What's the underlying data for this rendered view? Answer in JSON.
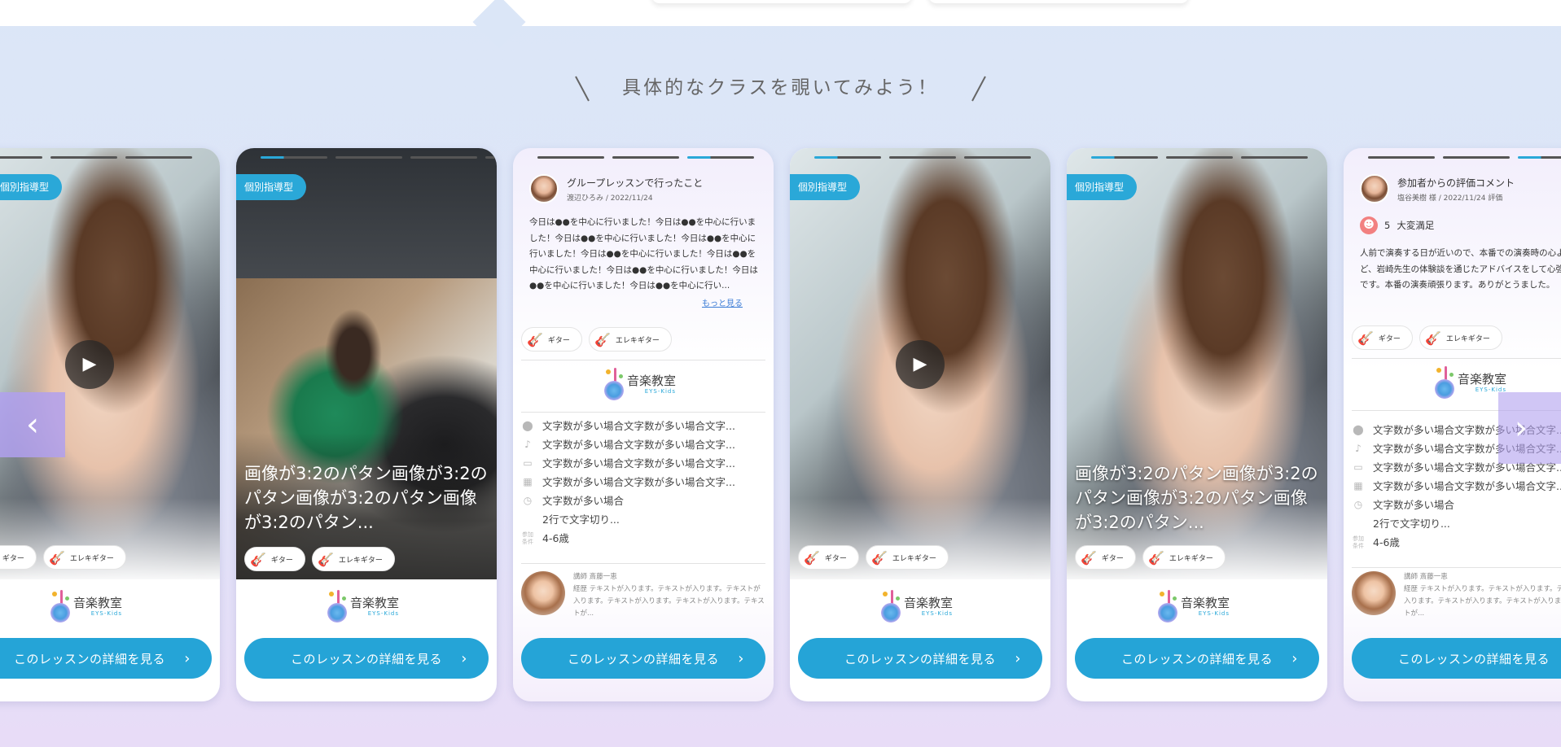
{
  "heading": "具体的なクラスを覗いてみよう！",
  "common": {
    "badge": "個別指導型",
    "tags": [
      "ギター",
      "エレキギター"
    ],
    "logo_name": "音楽教室",
    "logo_sub": "EYS-Kids",
    "cta": "このレッスンの詳細を見る",
    "play_icon": "▶"
  },
  "photo_caption": "画像が3:2のパタン画像が3:2のパタン画像が3:2のパタン画像が3:2のパタン...",
  "report": {
    "title": "グループレッスンで行ったこと",
    "meta": "渡辺ひろみ / 2022/11/24",
    "body": "今日は●●を中心に行いました！今日は●●を中心に行いました！今日は●●を中心に行いました！今日は●●を中心に行いました！今日は●●を中心に行いました！今日は●●を中心に行いました！今日は●●を中心に行いました！今日は●●を中心に行いました！今日は●●を中心に行い...",
    "more": "もっと見る"
  },
  "review": {
    "title": "参加者からの評価コメント",
    "meta": "塩谷美樹 様 / 2022/11/24 評価",
    "rating": "5",
    "rating_label": "大変満足",
    "body": "人前で演奏する日が近いので、本番での演奏時の心ようなど、岩崎先生の体験談を通じたアドバイスをして心強かったです。本番の演奏頑張ります。ありがとうました。"
  },
  "info": {
    "place": "文字数が多い場合文字数が多い場合文字...",
    "music": "文字数が多い場合文字数が多い場合文字...",
    "style": "文字数が多い場合文字数が多い場合文字...",
    "date": "文字数が多い場合文字数が多い場合文字...",
    "time_1": "文字数が多い場合",
    "time_2": "2行で文字切り...",
    "cond_label": "参加条件",
    "age": "4-6歳"
  },
  "teacher": {
    "name": "講師 斎藤一恵",
    "career": "経歴 テキストが入ります。テキストが入ります。テキストが入ります。テキストが入ります。テキストが入ります。テキストが..."
  },
  "colors": {
    "accent": "#25a4d7",
    "arrow": "#b0a0ee"
  }
}
